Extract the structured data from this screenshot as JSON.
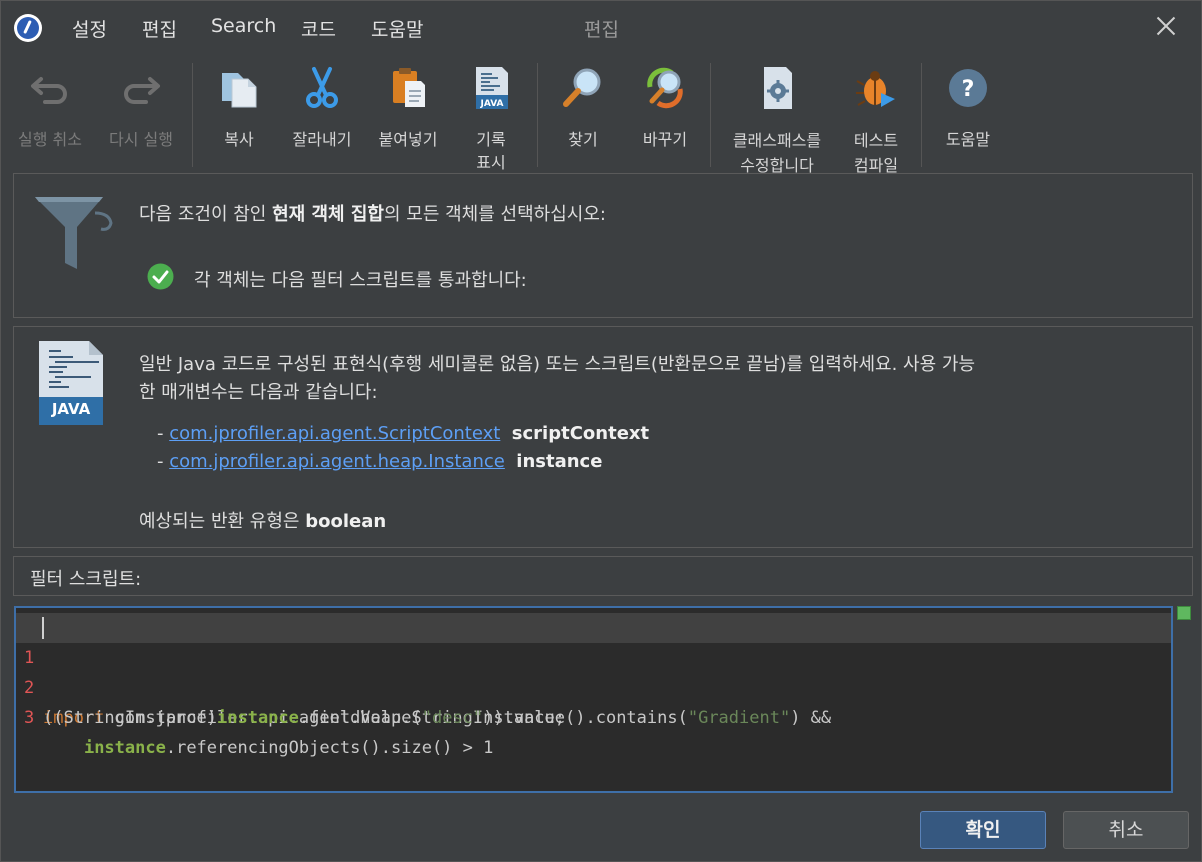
{
  "menu": {
    "items": [
      "설정",
      "편집",
      "Search",
      "코드",
      "도움말"
    ],
    "title": "편집"
  },
  "toolbar": {
    "undo": "실행 취소",
    "redo": "다시 실행",
    "copy": "복사",
    "cut": "잘라내기",
    "paste": "붙여넣기",
    "history_1": "기록",
    "history_2": "표시",
    "find": "찾기",
    "replace": "바꾸기",
    "classpath_1": "클래스패스를",
    "classpath_2": "수정합니다",
    "test_1": "테스트",
    "test_2": "컴파일",
    "help": "도움말"
  },
  "condition": {
    "prefix": "다음 조건이 참인 ",
    "bold": "현재 객체 집합",
    "suffix": "의 모든 객체를 선택하십시오:",
    "check_text": "각 객체는 다음 필터 스크립트를 통과합니다:"
  },
  "info": {
    "line1": "일반 Java 코드로 구성된 표현식(후행 세미콜론 없음) 또는 스크립트(반환문으로 끝남)를 입력하세요. 사용 가능",
    "line2": "한 매개변수는 다음과 같습니다:",
    "params": [
      {
        "type": "com.jprofiler.api.agent.ScriptContext",
        "name": "scriptContext"
      },
      {
        "type": "com.jprofiler.api.agent.heap.Instance",
        "name": "instance"
      }
    ],
    "return_prefix": "예상되는 반환 유형은 ",
    "return_type": "boolean",
    "java_label": "JAVA"
  },
  "filter_label": "필터 스크립트:",
  "code": {
    "line_numbers": [
      "1",
      "2",
      "3"
    ],
    "l1_kw": "import",
    "l1_rest": " com.jprofiler.api.agent.heap.StringInstance;",
    "l2_a": "((StringInstance)",
    "l2_var": "instance",
    "l2_b": ".fieldValue(",
    "l2_str1": "\"desc\"",
    "l2_c": ")).value().contains(",
    "l2_str2": "\"Gradient\"",
    "l2_d": ") &&",
    "l3_indent": "    ",
    "l3_var": "instance",
    "l3_rest": ".referencingObjects().size() > 1"
  },
  "buttons": {
    "ok": "확인",
    "cancel": "취소"
  }
}
